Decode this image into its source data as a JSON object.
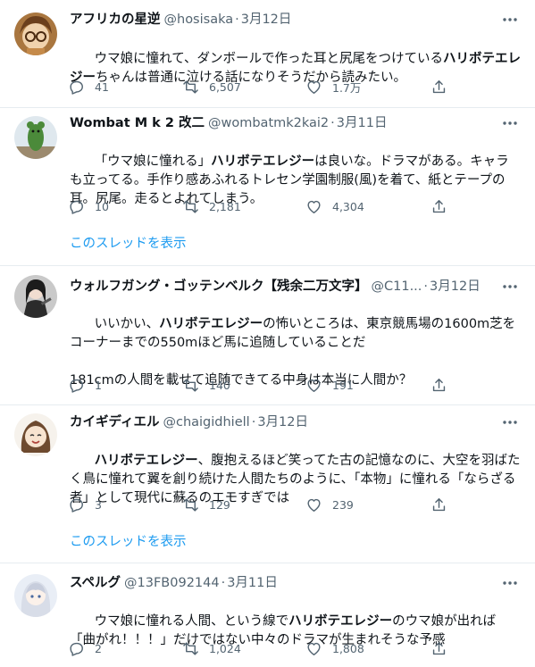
{
  "tweets": [
    {
      "name": "アフリカの星逆",
      "handle": "@hosisaka",
      "sep": "·",
      "date": "3月12日",
      "text_parts": [
        {
          "t": "ウマ娘に憧れて、ダンボールで作った耳と尻尾をつけている",
          "b": false
        },
        {
          "t": "ハリボテエレジー",
          "b": true
        },
        {
          "t": "ちゃんは普通に泣ける話になりそうだから読みたい。",
          "b": false
        }
      ],
      "replies": "41",
      "retweets": "6,507",
      "likes": "1.7万",
      "show_thread": ""
    },
    {
      "name": "Wombat M k 2 改二",
      "handle": "@wombatmk2kai2",
      "sep": "·",
      "date": "3月11日",
      "text_parts": [
        {
          "t": "「ウマ娘に憧れる」",
          "b": false
        },
        {
          "t": "ハリボテエレジー",
          "b": true
        },
        {
          "t": "は良いな。ドラマがある。キャラも立ってる。手作り感あふれるトレセン学園制服(風)を着て、紙とテープの耳。尻尾。走るとよれてしまう。",
          "b": false
        }
      ],
      "replies": "10",
      "retweets": "2,181",
      "likes": "4,304",
      "show_thread": "このスレッドを表示"
    },
    {
      "name": "ウォルフガング・ゴッテンベルク【残余二万文字】",
      "handle": "@C11...",
      "sep": "·",
      "date": "3月12日",
      "text_parts": [
        {
          "t": "いいかい、",
          "b": false
        },
        {
          "t": "ハリボテエレジー",
          "b": true
        },
        {
          "t": "の怖いところは、東京競馬場の1600m芝をコーナーまでの550mほど馬に追随していることだ\n\n181cmの人間を載せて追随できてる中身は本当に人間か？",
          "b": false
        }
      ],
      "replies": "1",
      "retweets": "140",
      "likes": "191",
      "show_thread": ""
    },
    {
      "name": "カイギディエル",
      "handle": "@chaigidhiell",
      "sep": "·",
      "date": "3月12日",
      "text_parts": [
        {
          "t": "ハリボテエレジー",
          "b": true
        },
        {
          "t": "、腹抱えるほど笑ってた古の記憶なのに、大空を羽ばたく鳥に憧れて翼を創り続けた人間たちのように、「本物」に憧れる「ならざる者」として現代に蘇るのエモすぎでは",
          "b": false
        }
      ],
      "replies": "3",
      "retweets": "129",
      "likes": "239",
      "show_thread": "このスレッドを表示"
    },
    {
      "name": "スペルグ",
      "handle": "@13FB092144",
      "sep": "·",
      "date": "3月11日",
      "text_parts": [
        {
          "t": "ウマ娘に憧れる人間、という線で",
          "b": false
        },
        {
          "t": "ハリボテエレジー",
          "b": true
        },
        {
          "t": "のウマ娘が出れば「曲がれ！！！」だけではない中々のドラマが生まれそうな予感",
          "b": false
        }
      ],
      "replies": "2",
      "retweets": "1,024",
      "likes": "1,808",
      "show_thread": ""
    }
  ],
  "colors": {
    "text": "#0f1419",
    "muted": "#536471",
    "link": "#1d9bf0",
    "divider": "#e6ecf0"
  },
  "icons": {
    "more": "more-horizontal-icon",
    "reply": "reply-icon",
    "retweet": "retweet-icon",
    "like": "heart-icon",
    "share": "share-icon"
  }
}
